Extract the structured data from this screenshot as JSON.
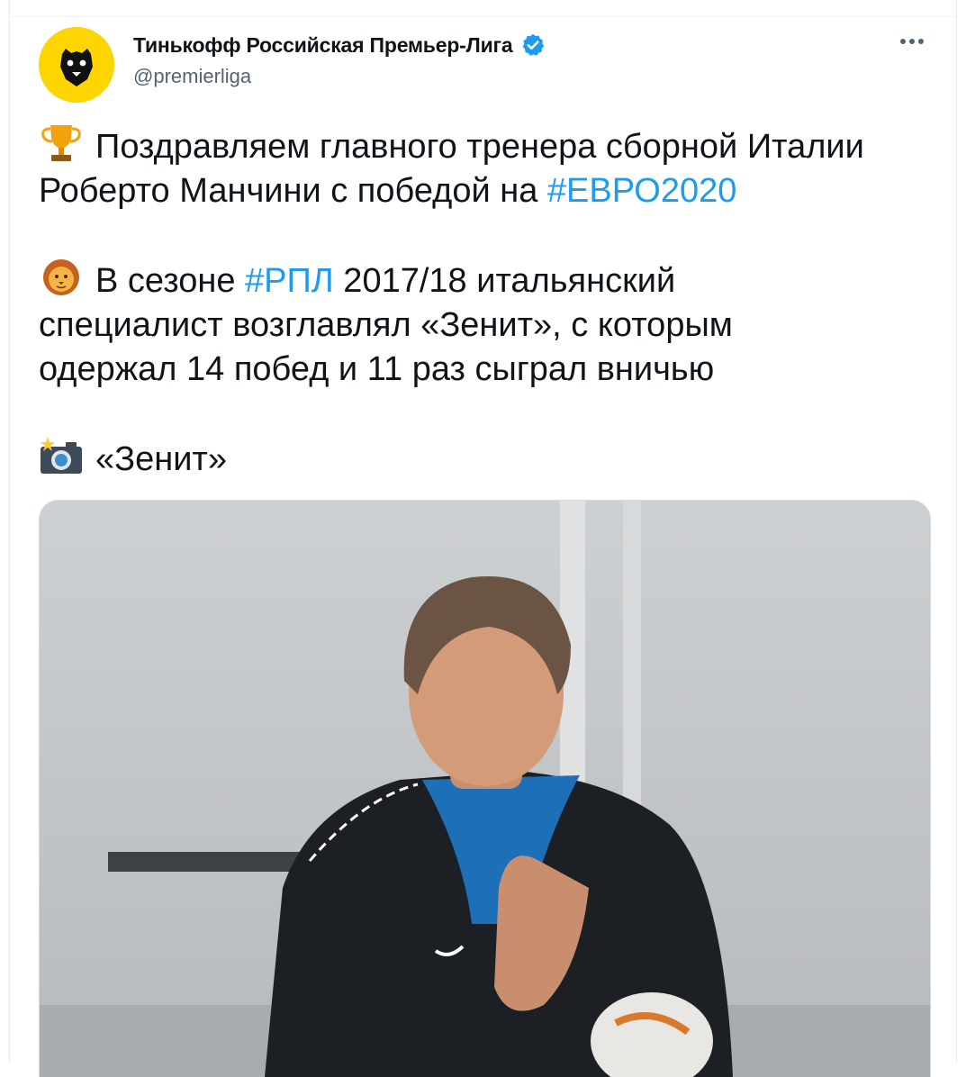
{
  "tweet": {
    "author": {
      "display_name": "Тинькофф Российская Премьер-Лига",
      "handle": "@premierliga",
      "verified": true,
      "avatar_icon": "bear-logo-icon"
    },
    "more_icon": "more-horizontal-icon",
    "paragraphs": {
      "p1": {
        "emoji": "trophy-icon",
        "line1": "Поздравляем главного тренера сборной Италии",
        "line2_pre": "Роберто Манчини с победой на ",
        "hashtag": "#ЕВРО2020"
      },
      "p2": {
        "emoji": "lion-icon",
        "pre": "В сезоне ",
        "hashtag": "#РПЛ",
        "post": " 2017/18 итальянский",
        "line2": "специалист возглавлял «Зенит», с которым",
        "line3": "одержал 14 побед и 11 раз сыграл вничью"
      },
      "p3": {
        "emoji": "camera-flash-icon",
        "text": "«Зенит»"
      }
    },
    "media": {
      "alt": "Роберто Манчини на тренировке «Зенита»"
    }
  },
  "colors": {
    "text": "#0f1419",
    "secondary": "#536471",
    "link": "#1d9bf0",
    "verified": "#1d9bf0",
    "avatar_bg": "#ffd500"
  }
}
